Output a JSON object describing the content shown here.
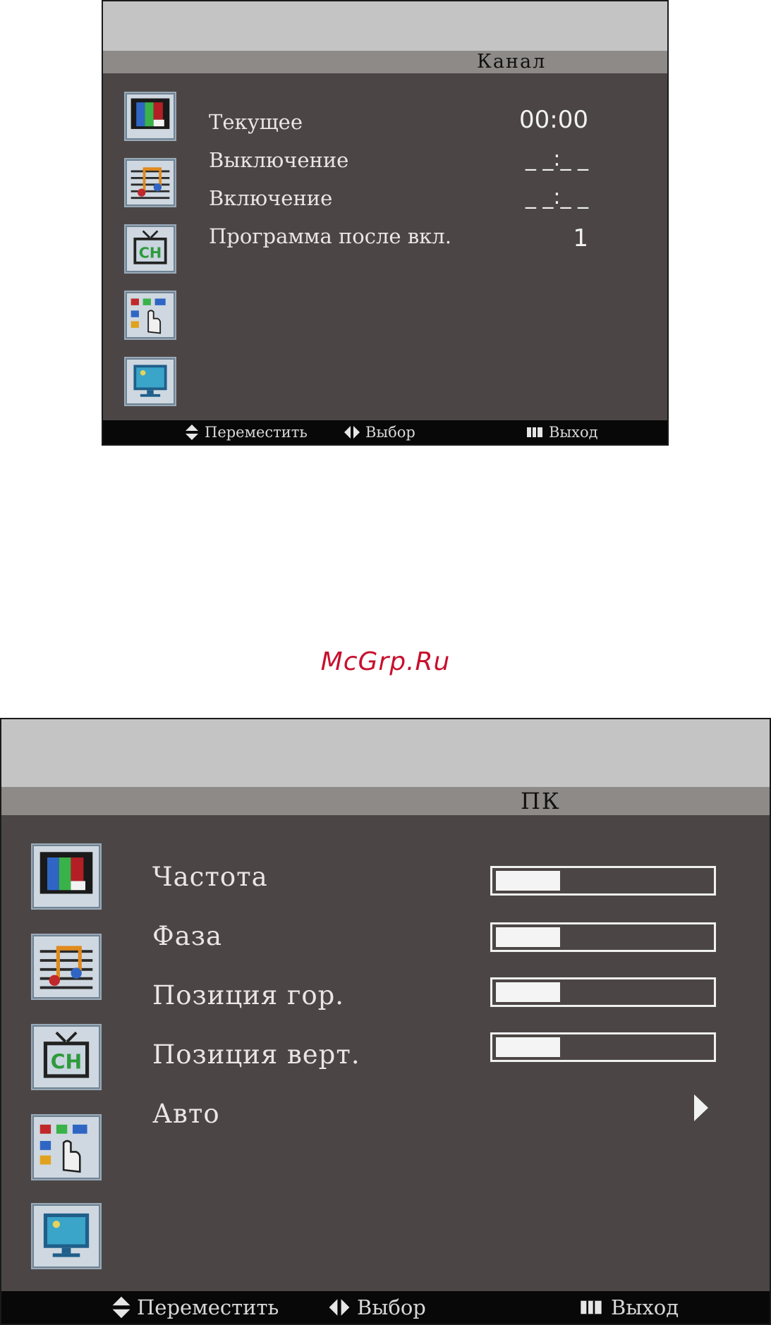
{
  "watermark": "McGrp.Ru",
  "icons": [
    "picture-icon",
    "audio-icon",
    "channel-icon",
    "function-icon",
    "pc-monitor-icon"
  ],
  "icon_channel_text": "CH",
  "menu1": {
    "title": "Канал",
    "rows": [
      {
        "label": "Текущее",
        "value": "00:00"
      },
      {
        "label": "Выключение",
        "value": "_ _:_ _"
      },
      {
        "label": "Включение",
        "value": "_ _:_ _"
      },
      {
        "label": "Программа после вкл.",
        "value": "1"
      }
    ],
    "footer": {
      "move": "Переместить",
      "select": "Выбор",
      "exit": "Выход"
    }
  },
  "menu2": {
    "title": "ПК",
    "rows": [
      {
        "label": "Частота",
        "level": 0.3
      },
      {
        "label": "Фаза",
        "level": 0.3
      },
      {
        "label": "Позиция гор.",
        "level": 0.3
      },
      {
        "label": "Позиция верт.",
        "level": 0.3
      },
      {
        "label": "Авто",
        "arrow": "right-arrow-icon"
      }
    ],
    "footer": {
      "move": "Переместить",
      "select": "Выбор",
      "exit": "Выход"
    }
  },
  "colors": {
    "panel": "#4b4645",
    "topbar": "#c4c4c4",
    "titlebar": "#8e8a88",
    "footer": "#080808",
    "watermark": "#c8102e"
  }
}
